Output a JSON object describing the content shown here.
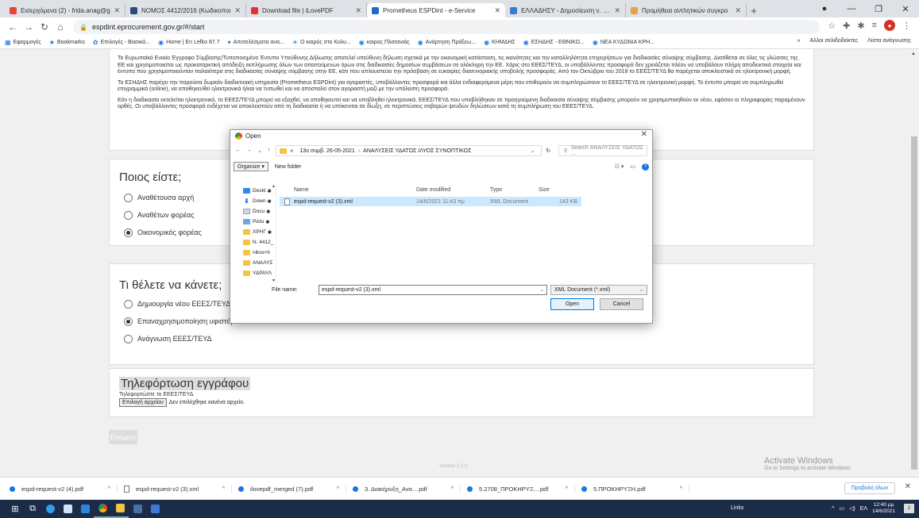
{
  "browser": {
    "tabs": [
      {
        "label": "Εισερχόμενα (2) - frida.anag@g",
        "color": "#ea4335"
      },
      {
        "label": "ΝΟΜΟΣ 4412/2016 (Κωδικοποι",
        "color": "#2a4b7c"
      },
      {
        "label": "Download file | iLovePDF",
        "color": "#e5322d"
      },
      {
        "label": "Prometheus ESPDint - e-Service",
        "color": "#1c6ec1"
      },
      {
        "label": "ΕΛΛΑΔΗΣΥ - Δημοσίευση ν. 4782",
        "color": "#3a7bd5"
      },
      {
        "label": "Προμήθεια αντλητικών συγκρο",
        "color": "#e8a33d"
      }
    ],
    "url": "espdint.eprocurement.gov.gr/#/start",
    "bookmarks": [
      "Εφαρμογές",
      "Bookmarks",
      "Επιλογές - Βασικά...",
      "Home | En Lefko 87.7",
      "Αποτελέσματα ανα...",
      "Ο καιρός στο Κολυ...",
      "καιρος Πλατανιάς",
      "Ανάρτηση Πράξεω...",
      "ΚΗΜΔΗΣ",
      "ΕΣΗΔΗΣ - ΕΘΝΙΚΟ...",
      "ΝΕΑ ΚΥΔΩΝΙΑ ΚΡΗ..."
    ],
    "bookmarks_right": [
      "»",
      "Άλλοι σελιδοδείκτες",
      "Λίστα ανάγνωσης"
    ]
  },
  "page": {
    "intro_p1": "Το Ευρωπαϊκό Ενιαίο Έγγραφο Σύμβασης/Τυποποιημένο Έντυπο Υπεύθυνης Δήλωσης αποτελεί υπεύθυνη δήλωση σχετικά με την οικονομική κατάσταση, τις ικανότητες και την καταλληλότητα επιχειρήσεων για διαδικασίες σύναψης σύμβασης. Διατίθεται σε όλες τις γλώσσες της ΕΕ και χρησιμοποιείται ως προκαταρκτική απόδειξη εκπλήρωσης όλων των απαιτούμενων όρων στις διαδικασίες δημοσίων συμβάσεων σε ολόκληρη την ΕΕ. Χάρις στο ΕΕΕΣ/ΤΕΥΔ, οι υποβάλλοντες προσφορά δεν χρειάζεται πλέον να υποβάλουν πλήρη αποδεικτικά στοιχεία και έντυπα που χρησιμοποιούνταν παλαιότερα στις διαδικασίες σύναψης σύμβασης στην ΕΕ, κάτι που απλουστεύει την πρόσβαση σε ευκαιρίες διασυνοριακής υποβολής προσφοράς. Από τον Οκτώβριο του 2018 το ΕΕΕΣ/ΤΕΥΔ θα παρέχεται αποκλειστικά σε ηλεκτρονική μορφή.",
    "intro_p2": "Το ΕΣΗΔΗΣ παρέχει την παρούσα δωρεάν διαδικτυακή υπηρεσία (Prometheus ESPDint) για αγοραστές, υποβάλλοντες προσφορά και άλλα ενδιαφερόμενα μέρη που επιθυμούν να συμπληρώσουν το ΕΕΕΣ/ΤΕΥΔ σε ηλεκτρονική μορφή. Το έντυπο μπορεί να συμπληρωθεί επιγραμμικά (online), να αποθηκευθεί ηλεκτρονικά ή/και να τυπωθεί και να αποσταλεί στον αγοραστή μαζί με την υπόλοιπη προσφορά.",
    "intro_p3": "Εάν η διαδικασία εκτελείται ηλεκτρονικά, το ΕΕΕΣ/ΤΕΥΔ μπορεί να εξαχθεί, να αποθηκευτεί και να υποβληθεί ηλεκτρονικά. ΕΕΕΣ/ΤΕΥΔ που υποβλήθηκαν σε προηγούμενη διαδικασία σύναψης σύμβασης μπορούν να χρησιμοποιηθούν εκ νέου, εφόσον οι πληροφορίες παραμένουν ορθές. Οι υποβάλλοντες προσφορά ενδέχεται να αποκλειστούν από τη διαδικασία ή να υπόκεινται σε δίωξη, σε περιπτώσεις σοβαρών ψευδών δηλώσεων κατά τη συμπλήρωση του ΕΕΕΣ/ΤΕΥΔ.",
    "who": {
      "title": "Ποιος είστε;",
      "options": [
        "Αναθέτουσα αρχή",
        "Αναθέτων φορέας",
        "Οικονομικός φορέας"
      ]
    },
    "what": {
      "title": "Τι θέλετε να κάνετε;",
      "options": [
        "Δημιουργία νέου ΕΕΕΣ/ΤΕΥΔ",
        "Επαναχρησιμοποίηση υφιστάμενου ΕΕΕΣ/ΤΕΥΔ",
        "Ανάγνωση ΕΕΕΣ/ΤΕΥΔ"
      ]
    },
    "upload": {
      "title": "Τηλεφόρτωση εγγράφου",
      "hint": "Τηλεφορτώστε το ΕΕΕΣ/ΤΕΥΔ",
      "button": "Επιλογή αρχείου",
      "nofile": "Δεν επιλέχθηκε κανένα αρχείο."
    },
    "next": "Επόμενο",
    "version": "Version 2.1.0"
  },
  "watermark": {
    "line1": "Activate Windows",
    "line2": "Go to Settings to activate Windows."
  },
  "dialog": {
    "title": "Open",
    "path": [
      "«",
      "13ο συμβ. 26-05-2021",
      "ΑΝΑΛΥΣΕΙΣ ΥΔΑΤΟΣ ΙΛΥΟΣ ΣΥΝΟΠΤΙΚΟΣ"
    ],
    "search_placeholder": "Search ΑΝΑΛΥΣΕΙΣ ΥΔΑΤΟΣ ...",
    "organize": "Organize ▾",
    "new_folder": "New folder",
    "nav": [
      "Deskt",
      "Down",
      "Docu",
      "Pictu",
      "ΧΡΗΓ",
      "Ν. 4412_",
      "nikos+li",
      "ΑΝΑΛΥΣ",
      "ΥΔΡΑΥΛ"
    ],
    "columns": {
      "name": "Name",
      "date": "Date modified",
      "type": "Type",
      "size": "Size"
    },
    "file": {
      "name": "espd-request-v2 (3).xml",
      "date": "14/6/2021 11:43 πμ",
      "type": "XML Document",
      "size": "143 KB"
    },
    "filename_label": "File name:",
    "filename_value": "espd-request-v2 (3).xml",
    "filetype": "XML Document (*.xml)",
    "open": "Open",
    "cancel": "Cancel"
  },
  "downloads": [
    {
      "name": "espd-request-v2 (4).pdf",
      "color": "#1a73e8"
    },
    {
      "name": "espd-request-v2 (3).xml",
      "color": ""
    },
    {
      "name": "ilovepdf_merged (7).pdf",
      "color": "#1a73e8"
    },
    {
      "name": "3. Διακήρυξη_Ανα....pdf",
      "color": "#1a73e8"
    },
    {
      "name": "5.2708_ΠΡΟΚΗΡΥΞ....pdf",
      "color": "#1a73e8"
    },
    {
      "name": "5.ΠΡΟΚΗΡΥΞΗ.pdf",
      "color": "#1a73e8"
    }
  ],
  "downloads_show_all": "Προβολή όλων",
  "taskbar": {
    "links": "Links",
    "lang": "ΕΛ",
    "time": "12:40 μμ",
    "date": "14/6/2021",
    "notif": "2"
  }
}
